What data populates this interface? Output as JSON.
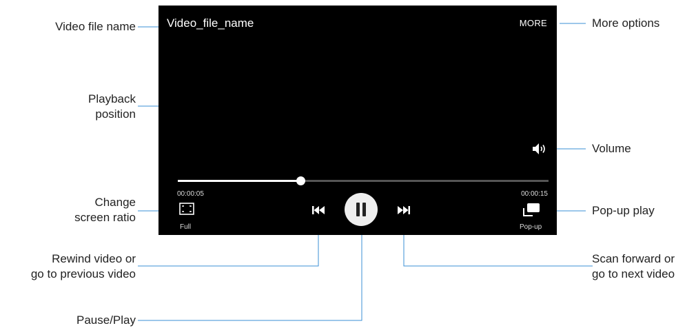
{
  "screen": {
    "file_name": "Video_file_name",
    "more_label": "MORE",
    "current_time": "00:00:05",
    "total_time": "00:00:15",
    "progress": 0.33,
    "ratio_label": "Full",
    "popup_label": "Pop-up"
  },
  "callouts": {
    "video_file_name": "Video file name",
    "playback_position_1": "Playback",
    "playback_position_2": "position",
    "change_ratio_1": "Change",
    "change_ratio_2": "screen ratio",
    "rewind_1": "Rewind video or",
    "rewind_2": "go to previous video",
    "pause_play": "Pause/Play",
    "more_options": "More options",
    "volume": "Volume",
    "popup_play": "Pop-up play",
    "scan_forward_1": "Scan forward or",
    "scan_forward_2": "go to next video"
  },
  "icons": {
    "volume": "volume-icon",
    "ratio": "screen-ratio-icon",
    "prev": "skip-previous-icon",
    "play": "pause-icon",
    "next": "skip-next-icon",
    "popup": "popup-icon"
  },
  "colors": {
    "screen_bg": "#000000",
    "callout_line": "#3a8fd6",
    "play_button_bg": "#eeeeee"
  }
}
